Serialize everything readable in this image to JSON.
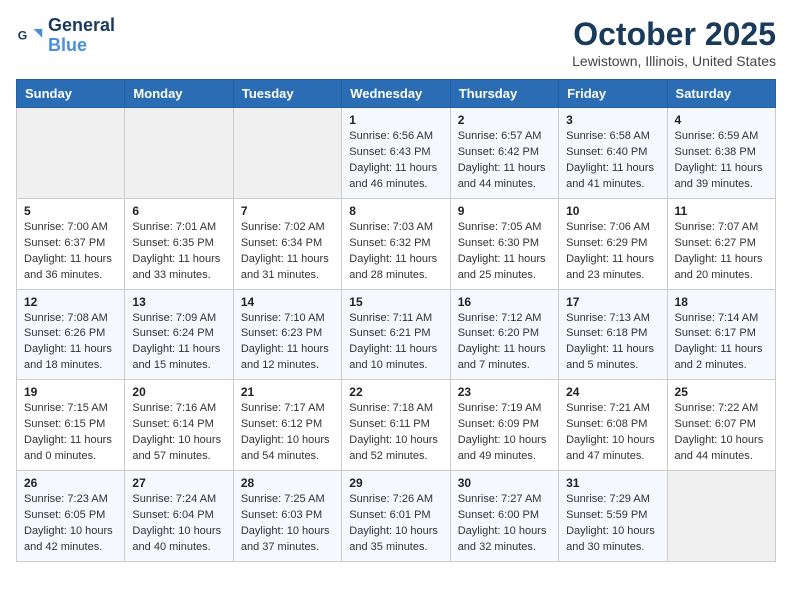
{
  "header": {
    "logo_line1": "General",
    "logo_line2": "Blue",
    "month": "October 2025",
    "location": "Lewistown, Illinois, United States"
  },
  "weekdays": [
    "Sunday",
    "Monday",
    "Tuesday",
    "Wednesday",
    "Thursday",
    "Friday",
    "Saturday"
  ],
  "weeks": [
    [
      {
        "day": "",
        "content": ""
      },
      {
        "day": "",
        "content": ""
      },
      {
        "day": "",
        "content": ""
      },
      {
        "day": "1",
        "content": "Sunrise: 6:56 AM\nSunset: 6:43 PM\nDaylight: 11 hours and 46 minutes."
      },
      {
        "day": "2",
        "content": "Sunrise: 6:57 AM\nSunset: 6:42 PM\nDaylight: 11 hours and 44 minutes."
      },
      {
        "day": "3",
        "content": "Sunrise: 6:58 AM\nSunset: 6:40 PM\nDaylight: 11 hours and 41 minutes."
      },
      {
        "day": "4",
        "content": "Sunrise: 6:59 AM\nSunset: 6:38 PM\nDaylight: 11 hours and 39 minutes."
      }
    ],
    [
      {
        "day": "5",
        "content": "Sunrise: 7:00 AM\nSunset: 6:37 PM\nDaylight: 11 hours and 36 minutes."
      },
      {
        "day": "6",
        "content": "Sunrise: 7:01 AM\nSunset: 6:35 PM\nDaylight: 11 hours and 33 minutes."
      },
      {
        "day": "7",
        "content": "Sunrise: 7:02 AM\nSunset: 6:34 PM\nDaylight: 11 hours and 31 minutes."
      },
      {
        "day": "8",
        "content": "Sunrise: 7:03 AM\nSunset: 6:32 PM\nDaylight: 11 hours and 28 minutes."
      },
      {
        "day": "9",
        "content": "Sunrise: 7:05 AM\nSunset: 6:30 PM\nDaylight: 11 hours and 25 minutes."
      },
      {
        "day": "10",
        "content": "Sunrise: 7:06 AM\nSunset: 6:29 PM\nDaylight: 11 hours and 23 minutes."
      },
      {
        "day": "11",
        "content": "Sunrise: 7:07 AM\nSunset: 6:27 PM\nDaylight: 11 hours and 20 minutes."
      }
    ],
    [
      {
        "day": "12",
        "content": "Sunrise: 7:08 AM\nSunset: 6:26 PM\nDaylight: 11 hours and 18 minutes."
      },
      {
        "day": "13",
        "content": "Sunrise: 7:09 AM\nSunset: 6:24 PM\nDaylight: 11 hours and 15 minutes."
      },
      {
        "day": "14",
        "content": "Sunrise: 7:10 AM\nSunset: 6:23 PM\nDaylight: 11 hours and 12 minutes."
      },
      {
        "day": "15",
        "content": "Sunrise: 7:11 AM\nSunset: 6:21 PM\nDaylight: 11 hours and 10 minutes."
      },
      {
        "day": "16",
        "content": "Sunrise: 7:12 AM\nSunset: 6:20 PM\nDaylight: 11 hours and 7 minutes."
      },
      {
        "day": "17",
        "content": "Sunrise: 7:13 AM\nSunset: 6:18 PM\nDaylight: 11 hours and 5 minutes."
      },
      {
        "day": "18",
        "content": "Sunrise: 7:14 AM\nSunset: 6:17 PM\nDaylight: 11 hours and 2 minutes."
      }
    ],
    [
      {
        "day": "19",
        "content": "Sunrise: 7:15 AM\nSunset: 6:15 PM\nDaylight: 11 hours and 0 minutes."
      },
      {
        "day": "20",
        "content": "Sunrise: 7:16 AM\nSunset: 6:14 PM\nDaylight: 10 hours and 57 minutes."
      },
      {
        "day": "21",
        "content": "Sunrise: 7:17 AM\nSunset: 6:12 PM\nDaylight: 10 hours and 54 minutes."
      },
      {
        "day": "22",
        "content": "Sunrise: 7:18 AM\nSunset: 6:11 PM\nDaylight: 10 hours and 52 minutes."
      },
      {
        "day": "23",
        "content": "Sunrise: 7:19 AM\nSunset: 6:09 PM\nDaylight: 10 hours and 49 minutes."
      },
      {
        "day": "24",
        "content": "Sunrise: 7:21 AM\nSunset: 6:08 PM\nDaylight: 10 hours and 47 minutes."
      },
      {
        "day": "25",
        "content": "Sunrise: 7:22 AM\nSunset: 6:07 PM\nDaylight: 10 hours and 44 minutes."
      }
    ],
    [
      {
        "day": "26",
        "content": "Sunrise: 7:23 AM\nSunset: 6:05 PM\nDaylight: 10 hours and 42 minutes."
      },
      {
        "day": "27",
        "content": "Sunrise: 7:24 AM\nSunset: 6:04 PM\nDaylight: 10 hours and 40 minutes."
      },
      {
        "day": "28",
        "content": "Sunrise: 7:25 AM\nSunset: 6:03 PM\nDaylight: 10 hours and 37 minutes."
      },
      {
        "day": "29",
        "content": "Sunrise: 7:26 AM\nSunset: 6:01 PM\nDaylight: 10 hours and 35 minutes."
      },
      {
        "day": "30",
        "content": "Sunrise: 7:27 AM\nSunset: 6:00 PM\nDaylight: 10 hours and 32 minutes."
      },
      {
        "day": "31",
        "content": "Sunrise: 7:29 AM\nSunset: 5:59 PM\nDaylight: 10 hours and 30 minutes."
      },
      {
        "day": "",
        "content": ""
      }
    ]
  ]
}
